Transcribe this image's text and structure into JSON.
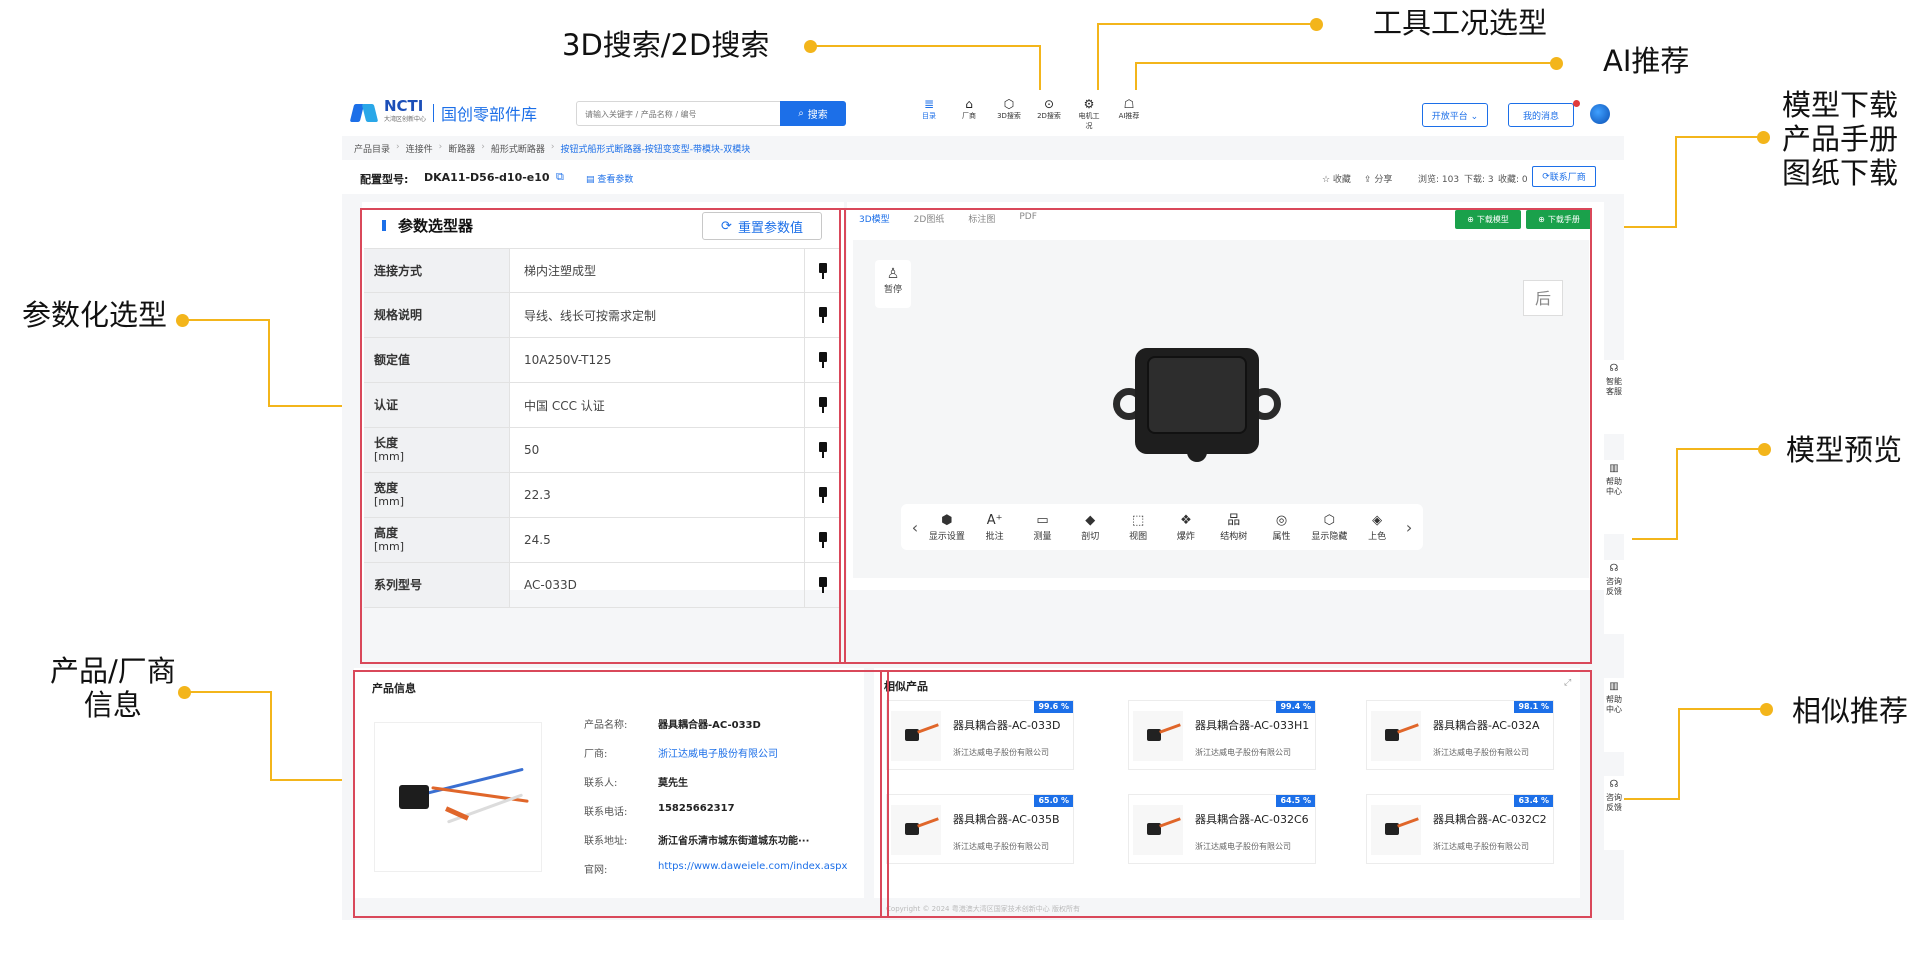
{
  "annotations": {
    "search": "3D搜索/2D搜索",
    "tool": "工具工况选型",
    "ai": "AI推荐",
    "download": [
      "模型下载",
      "产品手册",
      "图纸下载"
    ],
    "param": "参数化选型",
    "preview": "模型预览",
    "vendor": [
      "产品/厂商",
      "信息"
    ],
    "similar": "相似推荐"
  },
  "header": {
    "logo_en": "NCTI",
    "logo_sub": "大湾区创新中心",
    "logo_cn": "国创零部件库",
    "search_placeholder": "请输入关键字 / 产品名称 / 编号",
    "search_button": "搜索",
    "nav": [
      {
        "label": "目录",
        "icon": "≣"
      },
      {
        "label": "厂商",
        "icon": "⌂"
      },
      {
        "label": "3D搜索",
        "icon": "⬡"
      },
      {
        "label": "2D搜索",
        "icon": "⊙"
      },
      {
        "label": "电机工况",
        "icon": "⚙"
      },
      {
        "label": "AI推荐",
        "icon": "☖"
      }
    ],
    "open_platform": "开放平台 ⌄",
    "messages": "我的消息"
  },
  "breadcrumb": [
    "产品目录",
    "连接件",
    "断路器",
    "船形式断路器",
    "按钮式船形式断路器-按钮变变型-带模块-双模块"
  ],
  "model": {
    "label": "配置型号:",
    "value": "DKA11-D56-d10-e10",
    "view_params": "查看参数",
    "favorite": "☆ 收藏",
    "share": "分享",
    "views": "浏览: 103",
    "downloads": "下载: 3",
    "collects": "收藏: 0",
    "contact": "联系厂商"
  },
  "param_selector": {
    "title": "参数选型器",
    "reset": "重置参数值",
    "rows": [
      {
        "name": "连接方式",
        "unit": "",
        "value": "梯内注塑成型"
      },
      {
        "name": "规格说明",
        "unit": "",
        "value": "导线、线长可按需求定制"
      },
      {
        "name": "额定值",
        "unit": "",
        "value": "10A250V-T125"
      },
      {
        "name": "认证",
        "unit": "",
        "value": "中国 CCC 认证"
      },
      {
        "name": "长度",
        "unit": "[mm]",
        "value": "50"
      },
      {
        "name": "宽度",
        "unit": "[mm]",
        "value": "22.3"
      },
      {
        "name": "高度",
        "unit": "[mm]",
        "value": "24.5"
      },
      {
        "name": "系列型号",
        "unit": "",
        "value": "AC-033D"
      }
    ]
  },
  "viewer": {
    "tabs": [
      "3D模型",
      "2D图纸",
      "标注图",
      "PDF"
    ],
    "download_model": "下载模型",
    "download_manual": "下载手册",
    "pause": "暂停",
    "cube_face": "后",
    "toolbar": [
      {
        "label": "显示设置",
        "icon": "⬢"
      },
      {
        "label": "批注",
        "icon": "A⁺"
      },
      {
        "label": "测量",
        "icon": "▭"
      },
      {
        "label": "剖切",
        "icon": "◆"
      },
      {
        "label": "视图",
        "icon": "⬚"
      },
      {
        "label": "爆炸",
        "icon": "❖"
      },
      {
        "label": "结构树",
        "icon": "品"
      },
      {
        "label": "属性",
        "icon": "◎"
      },
      {
        "label": "显示隐藏",
        "icon": "⬡"
      },
      {
        "label": "上色",
        "icon": "◈"
      }
    ]
  },
  "product_info": {
    "title": "产品信息",
    "rows": [
      {
        "k": "产品名称:",
        "v": "器具耦合器-AC-033D"
      },
      {
        "k": "厂商:",
        "v": "浙江达威电子股份有限公司"
      },
      {
        "k": "联系人:",
        "v": "莫先生"
      },
      {
        "k": "联系电话:",
        "v": "15825662317"
      },
      {
        "k": "联系地址:",
        "v": "浙江省乐清市城东街道城东功能···"
      },
      {
        "k": "官网:",
        "v": "https://www.daweiele.com/index.aspx"
      }
    ]
  },
  "similar": {
    "title": "相似产品",
    "items": [
      {
        "name": "器具耦合器-AC-033D",
        "company": "浙江达威电子股份有限公司",
        "score": "99.6 %"
      },
      {
        "name": "器具耦合器-AC-033H1",
        "company": "浙江达威电子股份有限公司",
        "score": "99.4 %"
      },
      {
        "name": "器具耦合器-AC-032A",
        "company": "浙江达威电子股份有限公司",
        "score": "98.1 %"
      },
      {
        "name": "器具耦合器-AC-035B",
        "company": "浙江达威电子股份有限公司",
        "score": "65.0 %"
      },
      {
        "name": "器具耦合器-AC-032C6",
        "company": "浙江达威电子股份有限公司",
        "score": "64.5 %"
      },
      {
        "name": "器具耦合器-AC-032C2",
        "company": "浙江达威电子股份有限公司",
        "score": "63.4 %"
      }
    ]
  },
  "rail": [
    "智能客服",
    "帮助中心",
    "咨询反馈",
    "帮助中心",
    "咨询反馈"
  ],
  "footer": "Copyright © 2024 粤港澳大湾区国家技术创新中心 版权所有"
}
